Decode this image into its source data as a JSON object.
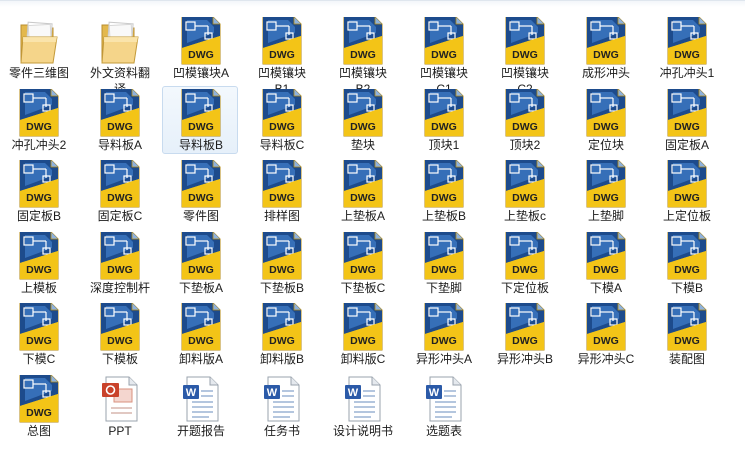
{
  "rows": [
    [
      {
        "label": "零件三维图",
        "icon": "folder-icon"
      },
      {
        "label": "外文资料翻\n译",
        "icon": "folder-icon"
      },
      {
        "label": "凹模镶块A",
        "icon": "dwg-file-icon",
        "badge": "DWG"
      },
      {
        "label": "凹模镶块\nB1",
        "icon": "dwg-file-icon",
        "badge": "DWG"
      },
      {
        "label": "凹模镶块\nB2",
        "icon": "dwg-file-icon",
        "badge": "DWG"
      },
      {
        "label": "凹模镶块\nC1",
        "icon": "dwg-file-icon",
        "badge": "DWG"
      },
      {
        "label": "凹模镶块\nC2",
        "icon": "dwg-file-icon",
        "badge": "DWG"
      },
      {
        "label": "成形冲头",
        "icon": "dwg-file-icon",
        "badge": "DWG"
      },
      {
        "label": "冲孔冲头1",
        "icon": "dwg-file-icon",
        "badge": "DWG"
      }
    ],
    [
      {
        "label": "冲孔冲头2",
        "icon": "dwg-file-icon",
        "badge": "DWG"
      },
      {
        "label": "导料板A",
        "icon": "dwg-file-icon",
        "badge": "DWG"
      },
      {
        "label": "导料板B",
        "icon": "dwg-file-icon",
        "badge": "DWG",
        "selected": true
      },
      {
        "label": "导料板C",
        "icon": "dwg-file-icon",
        "badge": "DWG"
      },
      {
        "label": "垫块",
        "icon": "dwg-file-icon",
        "badge": "DWG"
      },
      {
        "label": "顶块1",
        "icon": "dwg-file-icon",
        "badge": "DWG"
      },
      {
        "label": "顶块2",
        "icon": "dwg-file-icon",
        "badge": "DWG"
      },
      {
        "label": "定位块",
        "icon": "dwg-file-icon",
        "badge": "DWG"
      },
      {
        "label": "固定板A",
        "icon": "dwg-file-icon",
        "badge": "DWG"
      }
    ],
    [
      {
        "label": "固定板B",
        "icon": "dwg-file-icon",
        "badge": "DWG"
      },
      {
        "label": "固定板C",
        "icon": "dwg-file-icon",
        "badge": "DWG"
      },
      {
        "label": "零件图",
        "icon": "dwg-file-icon",
        "badge": "DWG"
      },
      {
        "label": "排样图",
        "icon": "dwg-file-icon",
        "badge": "DWG"
      },
      {
        "label": "上垫板A",
        "icon": "dwg-file-icon",
        "badge": "DWG"
      },
      {
        "label": "上垫板B",
        "icon": "dwg-file-icon",
        "badge": "DWG"
      },
      {
        "label": "上垫板c",
        "icon": "dwg-file-icon",
        "badge": "DWG"
      },
      {
        "label": "上垫脚",
        "icon": "dwg-file-icon",
        "badge": "DWG"
      },
      {
        "label": "上定位板",
        "icon": "dwg-file-icon",
        "badge": "DWG"
      }
    ],
    [
      {
        "label": "上模板",
        "icon": "dwg-file-icon",
        "badge": "DWG"
      },
      {
        "label": "深度控制杆",
        "icon": "dwg-file-icon",
        "badge": "DWG"
      },
      {
        "label": "下垫板A",
        "icon": "dwg-file-icon",
        "badge": "DWG"
      },
      {
        "label": "下垫板B",
        "icon": "dwg-file-icon",
        "badge": "DWG"
      },
      {
        "label": "下垫板C",
        "icon": "dwg-file-icon",
        "badge": "DWG"
      },
      {
        "label": "下垫脚",
        "icon": "dwg-file-icon",
        "badge": "DWG"
      },
      {
        "label": "下定位板",
        "icon": "dwg-file-icon",
        "badge": "DWG"
      },
      {
        "label": "下模A",
        "icon": "dwg-file-icon",
        "badge": "DWG"
      },
      {
        "label": "下模B",
        "icon": "dwg-file-icon",
        "badge": "DWG"
      }
    ],
    [
      {
        "label": "下模C",
        "icon": "dwg-file-icon",
        "badge": "DWG"
      },
      {
        "label": "下模板",
        "icon": "dwg-file-icon",
        "badge": "DWG"
      },
      {
        "label": "卸料版A",
        "icon": "dwg-file-icon",
        "badge": "DWG"
      },
      {
        "label": "卸料版B",
        "icon": "dwg-file-icon",
        "badge": "DWG"
      },
      {
        "label": "卸料版C",
        "icon": "dwg-file-icon",
        "badge": "DWG"
      },
      {
        "label": "异形冲头A",
        "icon": "dwg-file-icon",
        "badge": "DWG"
      },
      {
        "label": "异形冲头B",
        "icon": "dwg-file-icon",
        "badge": "DWG"
      },
      {
        "label": "异形冲头C",
        "icon": "dwg-file-icon",
        "badge": "DWG"
      },
      {
        "label": "装配图",
        "icon": "dwg-file-icon",
        "badge": "DWG"
      }
    ],
    [
      {
        "label": "总图",
        "icon": "dwg-file-icon",
        "badge": "DWG"
      },
      {
        "label": "PPT",
        "icon": "ppt-file-icon"
      },
      {
        "label": "开题报告",
        "icon": "word-file-icon"
      },
      {
        "label": "任务书",
        "icon": "word-file-icon"
      },
      {
        "label": "设计说明书",
        "icon": "word-file-icon"
      },
      {
        "label": "选题表",
        "icon": "word-file-icon"
      }
    ]
  ],
  "colors": {
    "dwg_yellow": "#f2c21a",
    "dwg_blue": "#1e4f8f",
    "selection": "#e6f0fa",
    "word_blue": "#2b5aa8",
    "ppt_red": "#c9422b"
  }
}
